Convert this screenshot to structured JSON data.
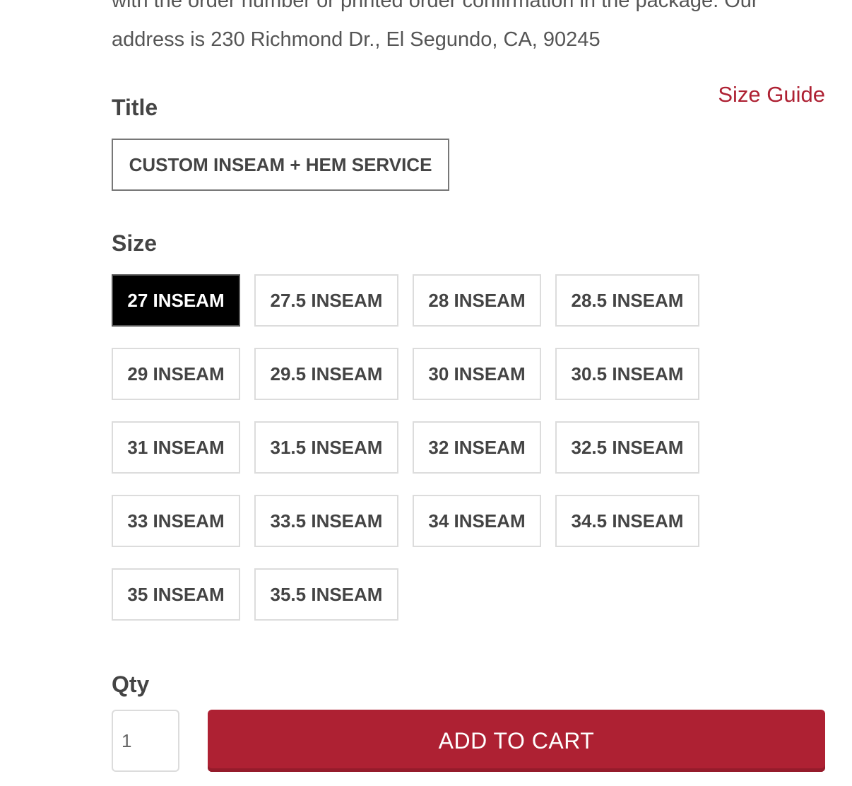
{
  "description": {
    "line1": "with the order number or printed order confirmation in the package. Our",
    "line2": "address is 230 Richmond Dr., El Segundo, CA, 90245"
  },
  "title_section": {
    "label": "Title",
    "size_guide_label": "Size Guide",
    "selected_option": "CUSTOM INSEAM + HEM SERVICE"
  },
  "size_section": {
    "label": "Size",
    "selected": "27 INSEAM",
    "options": [
      "27 INSEAM",
      "27.5 INSEAM",
      "28 INSEAM",
      "28.5 INSEAM",
      "29 INSEAM",
      "29.5 INSEAM",
      "30 INSEAM",
      "30.5 INSEAM",
      "31 INSEAM",
      "31.5 INSEAM",
      "32 INSEAM",
      "32.5 INSEAM",
      "33 INSEAM",
      "33.5 INSEAM",
      "34 INSEAM",
      "34.5 INSEAM",
      "35 INSEAM",
      "35.5 INSEAM"
    ]
  },
  "qty_section": {
    "label": "Qty",
    "value": "1"
  },
  "cart": {
    "add_to_cart_label": "ADD TO CART"
  },
  "colors": {
    "accent": "#ae2133",
    "selected_bg": "#000000",
    "text": "#444444"
  }
}
